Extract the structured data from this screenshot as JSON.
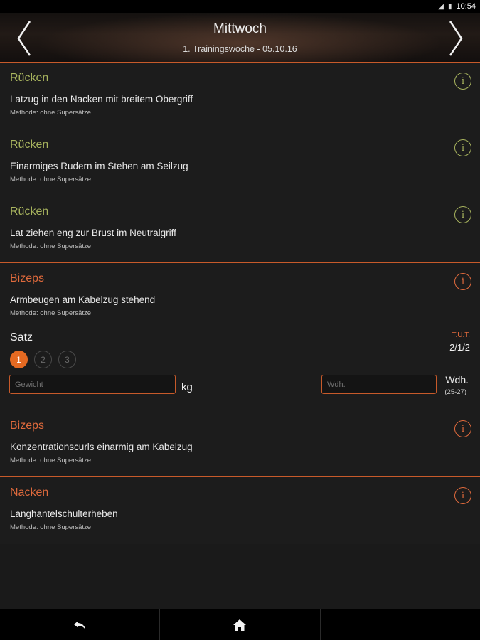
{
  "status_bar": {
    "time": "10:54"
  },
  "header": {
    "title": "Mittwoch",
    "subtitle": "1. Trainingswoche - 05.10.16"
  },
  "exercises": [
    {
      "category": "Rücken",
      "name": "Latzug in den Nacken mit breitem Obergriff",
      "method": "Methode: ohne Supersätze",
      "info": "i"
    },
    {
      "category": "Rücken",
      "name": "Einarmiges Rudern im Stehen am Seilzug",
      "method": "Methode: ohne Supersätze",
      "info": "i"
    },
    {
      "category": "Rücken",
      "name": "Lat ziehen eng zur Brust im Neutralgriff",
      "method": "Methode: ohne Supersätze",
      "info": "i"
    },
    {
      "category": "Bizeps",
      "name": "Armbeugen am Kabelzug stehend",
      "method": "Methode: ohne Supersätze",
      "info": "i"
    },
    {
      "category": "Bizeps",
      "name": "Konzentrationscurls einarmig am Kabelzug",
      "method": "Methode: ohne Supersätze",
      "info": "i"
    },
    {
      "category": "Nacken",
      "name": "Langhantelschulterheben",
      "method": "Methode: ohne Supersätze",
      "info": "i"
    }
  ],
  "active_set": {
    "satz_label": "Satz",
    "tut_label": "T.U.T.",
    "tut_value": "2/1/2",
    "sets": [
      "1",
      "2",
      "3"
    ],
    "selected_set": "1",
    "weight_placeholder": "Gewicht",
    "weight_unit": "kg",
    "reps_placeholder": "Wdh.",
    "reps_unit": "Wdh.",
    "reps_range": "(25-27)"
  },
  "colors": {
    "accent_orange": "#e06a3c",
    "accent_green": "#a8b45e",
    "background": "#1a1a1a"
  },
  "icons": {
    "back": "back-arrow-icon",
    "home": "home-icon",
    "prev": "chevron-left-icon",
    "next": "chevron-right-icon",
    "info": "info-icon"
  }
}
